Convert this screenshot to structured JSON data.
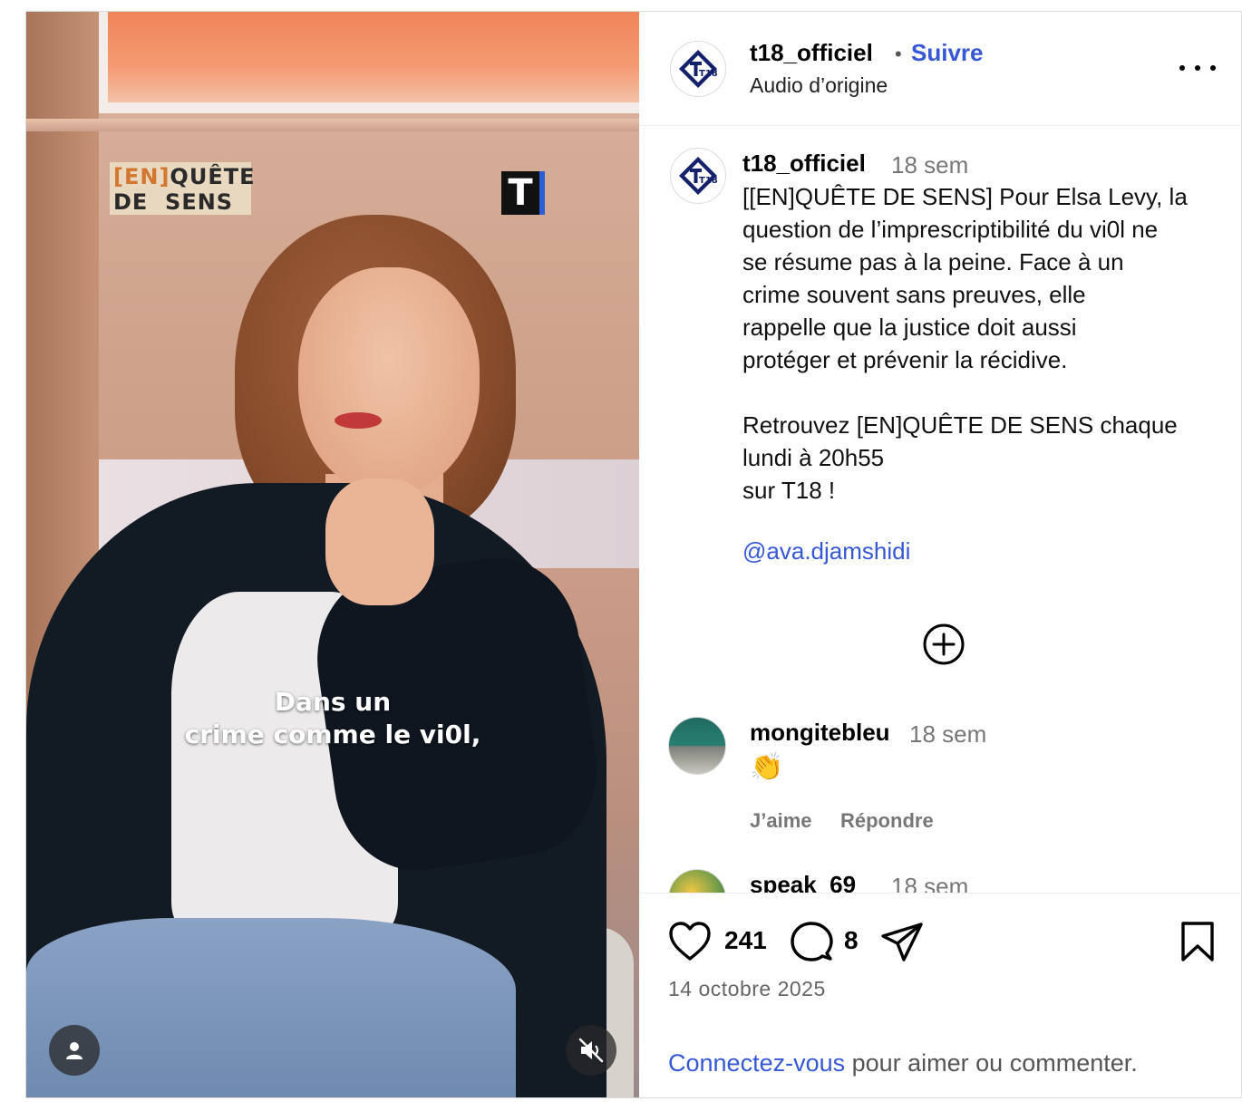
{
  "video": {
    "show_logo_bracket_open": "[EN]",
    "show_logo_line1_rest": "QUÊTE",
    "show_logo_line2": "DE  SENS",
    "channel_logo_letter": "T",
    "subtitle_line1": "Dans un",
    "subtitle_line2": "crime comme le vi0l,",
    "user_icon": "user-icon",
    "mute_icon": "speaker-muted-icon"
  },
  "header": {
    "account_name": "t18_officiel",
    "separator": "•",
    "follow_label": "Suivre",
    "audio_label": "Audio d’origine",
    "avatar_logo_text": "T18",
    "more_icon": "more-horizontal-icon"
  },
  "caption": {
    "author": "t18_officiel",
    "time": "18 sem",
    "text": "[[EN]QUÊTE DE SENS] Pour Elsa Levy, la\nquestion de l’imprescriptibilité du vi0l ne\nse résume pas à la peine. Face à un\ncrime souvent sans preuves, elle\nrappelle que la justice doit aussi\nprotéger et prévenir la récidive.\n\nRetrouvez [EN]QUÊTE DE SENS chaque\nlundi à 20h55\nsur T18 !",
    "mention": "@ava.djamshidi",
    "load_more_icon": "plus-circle-icon"
  },
  "comments": [
    {
      "author": "mongitebleu",
      "time": "18 sem",
      "text": "👏",
      "like_label": "J’aime",
      "reply_label": "Répondre"
    },
    {
      "author": "speak_69",
      "time": "18 sem"
    }
  ],
  "actions": {
    "like_count": "241",
    "comment_count": "8",
    "date": "14 octobre 2025",
    "login_link": "Connectez-vous",
    "login_rest": " pour aimer ou commenter."
  },
  "colors": {
    "accent": "#3758d6",
    "muted_text": "#777777",
    "border": "#dbdbdb",
    "logo_navy": "#14206b"
  }
}
